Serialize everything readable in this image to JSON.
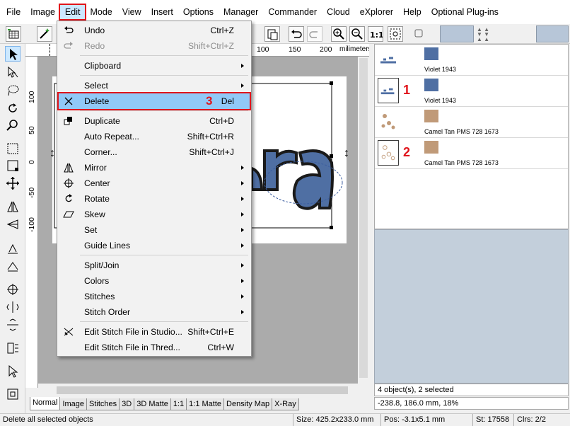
{
  "menubar": {
    "items": [
      {
        "label": "File"
      },
      {
        "label": "Image"
      },
      {
        "label": "Edit"
      },
      {
        "label": "Mode"
      },
      {
        "label": "View"
      },
      {
        "label": "Insert"
      },
      {
        "label": "Options"
      },
      {
        "label": "Manager"
      },
      {
        "label": "Commander"
      },
      {
        "label": "Cloud"
      },
      {
        "label": "eXplorer"
      },
      {
        "label": "Help"
      },
      {
        "label": "Optional Plug-ins"
      }
    ]
  },
  "ruler": {
    "top_labels": [
      "100",
      "150",
      "200"
    ],
    "top_unit": "milimeters",
    "left_labels": [
      "100",
      "50",
      "0",
      "-50",
      "-100"
    ]
  },
  "edit_menu": {
    "items": [
      {
        "label": "Undo",
        "shortcut": "Ctrl+Z",
        "icon": "undo-icon"
      },
      {
        "label": "Redo",
        "shortcut": "Shift+Ctrl+Z",
        "icon": "redo-icon",
        "disabled": true
      },
      {
        "label": "Clipboard",
        "submenu": true
      },
      {
        "label": "Select",
        "submenu": true
      },
      {
        "label": "Delete",
        "shortcut": "Del",
        "icon": "delete-x-icon",
        "step": "3"
      },
      {
        "label": "Duplicate",
        "shortcut": "Ctrl+D",
        "icon": "duplicate-icon"
      },
      {
        "label": "Auto Repeat...",
        "shortcut": "Shift+Ctrl+R"
      },
      {
        "label": "Corner...",
        "shortcut": "Shift+Ctrl+J"
      },
      {
        "label": "Mirror",
        "submenu": true,
        "icon": "mirror-icon"
      },
      {
        "label": "Center",
        "submenu": true,
        "icon": "center-crosshair-icon"
      },
      {
        "label": "Rotate",
        "submenu": true,
        "icon": "rotate-icon"
      },
      {
        "label": "Skew",
        "submenu": true,
        "icon": "skew-icon"
      },
      {
        "label": "Set",
        "submenu": true
      },
      {
        "label": "Guide Lines",
        "submenu": true
      },
      {
        "label": "Split/Join",
        "submenu": true
      },
      {
        "label": "Colors",
        "submenu": true
      },
      {
        "label": "Stitches",
        "submenu": true
      },
      {
        "label": "Stitch Order",
        "submenu": true
      },
      {
        "label": "Edit Stitch File in Studio...",
        "shortcut": "Shift+Ctrl+E",
        "icon": "stitch-studio-icon"
      },
      {
        "label": "Edit Stitch File in Thred...",
        "shortcut": "Ctrl+W"
      }
    ]
  },
  "objects": [
    {
      "color_name": "Violet 1943",
      "color": "#4f6fa3"
    },
    {
      "color_name": "Violet 1943",
      "color": "#4f6fa3",
      "marker": "1"
    },
    {
      "color_name": "Camel Tan PMS 728 1673",
      "color": "#c09a78"
    },
    {
      "color_name": "Camel Tan PMS 728 1673",
      "color": "#c09a78",
      "marker": "2"
    }
  ],
  "info": {
    "selection": "4 object(s), 2 selected",
    "coords": "-238.8, 186.0 mm, 18%"
  },
  "tabs": [
    {
      "label": "Normal"
    },
    {
      "label": "Image"
    },
    {
      "label": "Stitches"
    },
    {
      "label": "3D"
    },
    {
      "label": "3D Matte"
    },
    {
      "label": "1:1"
    },
    {
      "label": "1:1 Matte"
    },
    {
      "label": "Density Map"
    },
    {
      "label": "X-Ray"
    }
  ],
  "status": {
    "message": "Delete all selected objects",
    "size": "Size: 425.2x233.0 mm",
    "pos": "Pos: -3.1x5.1 mm",
    "st": "St: 17558",
    "clrs": "Clrs: 2/2"
  },
  "colors": {
    "highlight_red": "#e0151c",
    "menu_highlight": "#91c9f7",
    "design_blue": "#4f6fa3",
    "design_tan": "#c09a78"
  }
}
